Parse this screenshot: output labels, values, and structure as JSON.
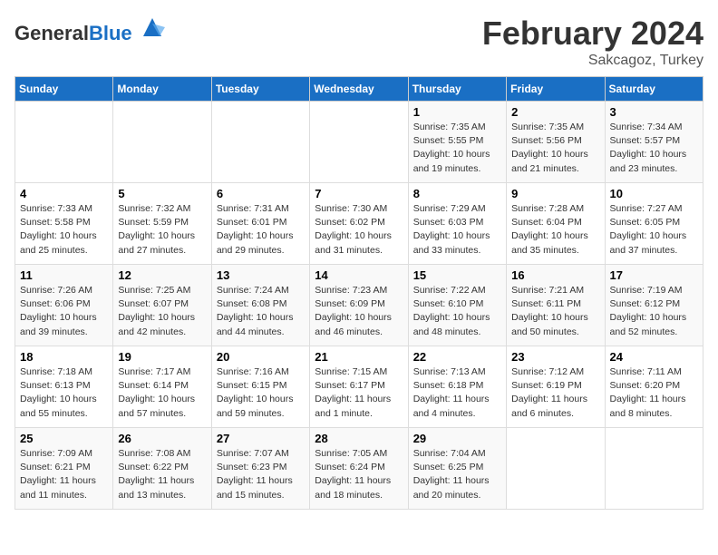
{
  "header": {
    "logo_general": "General",
    "logo_blue": "Blue",
    "month_title": "February 2024",
    "location": "Sakcagoz, Turkey"
  },
  "days_of_week": [
    "Sunday",
    "Monday",
    "Tuesday",
    "Wednesday",
    "Thursday",
    "Friday",
    "Saturday"
  ],
  "weeks": [
    [
      {
        "day": "",
        "info": ""
      },
      {
        "day": "",
        "info": ""
      },
      {
        "day": "",
        "info": ""
      },
      {
        "day": "",
        "info": ""
      },
      {
        "day": "1",
        "info": "Sunrise: 7:35 AM\nSunset: 5:55 PM\nDaylight: 10 hours\nand 19 minutes."
      },
      {
        "day": "2",
        "info": "Sunrise: 7:35 AM\nSunset: 5:56 PM\nDaylight: 10 hours\nand 21 minutes."
      },
      {
        "day": "3",
        "info": "Sunrise: 7:34 AM\nSunset: 5:57 PM\nDaylight: 10 hours\nand 23 minutes."
      }
    ],
    [
      {
        "day": "4",
        "info": "Sunrise: 7:33 AM\nSunset: 5:58 PM\nDaylight: 10 hours\nand 25 minutes."
      },
      {
        "day": "5",
        "info": "Sunrise: 7:32 AM\nSunset: 5:59 PM\nDaylight: 10 hours\nand 27 minutes."
      },
      {
        "day": "6",
        "info": "Sunrise: 7:31 AM\nSunset: 6:01 PM\nDaylight: 10 hours\nand 29 minutes."
      },
      {
        "day": "7",
        "info": "Sunrise: 7:30 AM\nSunset: 6:02 PM\nDaylight: 10 hours\nand 31 minutes."
      },
      {
        "day": "8",
        "info": "Sunrise: 7:29 AM\nSunset: 6:03 PM\nDaylight: 10 hours\nand 33 minutes."
      },
      {
        "day": "9",
        "info": "Sunrise: 7:28 AM\nSunset: 6:04 PM\nDaylight: 10 hours\nand 35 minutes."
      },
      {
        "day": "10",
        "info": "Sunrise: 7:27 AM\nSunset: 6:05 PM\nDaylight: 10 hours\nand 37 minutes."
      }
    ],
    [
      {
        "day": "11",
        "info": "Sunrise: 7:26 AM\nSunset: 6:06 PM\nDaylight: 10 hours\nand 39 minutes."
      },
      {
        "day": "12",
        "info": "Sunrise: 7:25 AM\nSunset: 6:07 PM\nDaylight: 10 hours\nand 42 minutes."
      },
      {
        "day": "13",
        "info": "Sunrise: 7:24 AM\nSunset: 6:08 PM\nDaylight: 10 hours\nand 44 minutes."
      },
      {
        "day": "14",
        "info": "Sunrise: 7:23 AM\nSunset: 6:09 PM\nDaylight: 10 hours\nand 46 minutes."
      },
      {
        "day": "15",
        "info": "Sunrise: 7:22 AM\nSunset: 6:10 PM\nDaylight: 10 hours\nand 48 minutes."
      },
      {
        "day": "16",
        "info": "Sunrise: 7:21 AM\nSunset: 6:11 PM\nDaylight: 10 hours\nand 50 minutes."
      },
      {
        "day": "17",
        "info": "Sunrise: 7:19 AM\nSunset: 6:12 PM\nDaylight: 10 hours\nand 52 minutes."
      }
    ],
    [
      {
        "day": "18",
        "info": "Sunrise: 7:18 AM\nSunset: 6:13 PM\nDaylight: 10 hours\nand 55 minutes."
      },
      {
        "day": "19",
        "info": "Sunrise: 7:17 AM\nSunset: 6:14 PM\nDaylight: 10 hours\nand 57 minutes."
      },
      {
        "day": "20",
        "info": "Sunrise: 7:16 AM\nSunset: 6:15 PM\nDaylight: 10 hours\nand 59 minutes."
      },
      {
        "day": "21",
        "info": "Sunrise: 7:15 AM\nSunset: 6:17 PM\nDaylight: 11 hours\nand 1 minute."
      },
      {
        "day": "22",
        "info": "Sunrise: 7:13 AM\nSunset: 6:18 PM\nDaylight: 11 hours\nand 4 minutes."
      },
      {
        "day": "23",
        "info": "Sunrise: 7:12 AM\nSunset: 6:19 PM\nDaylight: 11 hours\nand 6 minutes."
      },
      {
        "day": "24",
        "info": "Sunrise: 7:11 AM\nSunset: 6:20 PM\nDaylight: 11 hours\nand 8 minutes."
      }
    ],
    [
      {
        "day": "25",
        "info": "Sunrise: 7:09 AM\nSunset: 6:21 PM\nDaylight: 11 hours\nand 11 minutes."
      },
      {
        "day": "26",
        "info": "Sunrise: 7:08 AM\nSunset: 6:22 PM\nDaylight: 11 hours\nand 13 minutes."
      },
      {
        "day": "27",
        "info": "Sunrise: 7:07 AM\nSunset: 6:23 PM\nDaylight: 11 hours\nand 15 minutes."
      },
      {
        "day": "28",
        "info": "Sunrise: 7:05 AM\nSunset: 6:24 PM\nDaylight: 11 hours\nand 18 minutes."
      },
      {
        "day": "29",
        "info": "Sunrise: 7:04 AM\nSunset: 6:25 PM\nDaylight: 11 hours\nand 20 minutes."
      },
      {
        "day": "",
        "info": ""
      },
      {
        "day": "",
        "info": ""
      }
    ]
  ]
}
